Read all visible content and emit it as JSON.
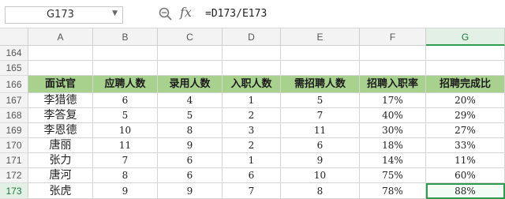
{
  "formula_bar": {
    "name_box": "G173",
    "formula": "=D173/E173"
  },
  "columns": [
    "A",
    "B",
    "C",
    "D",
    "E",
    "F",
    "G"
  ],
  "selected_column": "G",
  "rows": [
    {
      "num": "164",
      "cells": [
        "",
        "",
        "",
        "",
        "",
        "",
        ""
      ],
      "type": "blank"
    },
    {
      "num": "165",
      "cells": [
        "",
        "",
        "",
        "",
        "",
        "",
        ""
      ],
      "type": "blank"
    },
    {
      "num": "166",
      "cells": [
        "面试官",
        "应聘人数",
        "录用人数",
        "入职人数",
        "需招聘人数",
        "招聘入职率",
        "招聘完成比"
      ],
      "type": "header"
    },
    {
      "num": "167",
      "cells": [
        "李猎德",
        "6",
        "4",
        "1",
        "5",
        "17%",
        "20%"
      ],
      "type": "data"
    },
    {
      "num": "168",
      "cells": [
        "李答复",
        "5",
        "5",
        "2",
        "7",
        "40%",
        "29%"
      ],
      "type": "data"
    },
    {
      "num": "169",
      "cells": [
        "李恩德",
        "10",
        "8",
        "3",
        "11",
        "30%",
        "27%"
      ],
      "type": "data"
    },
    {
      "num": "170",
      "cells": [
        "唐丽",
        "11",
        "9",
        "2",
        "6",
        "18%",
        "33%"
      ],
      "type": "data"
    },
    {
      "num": "171",
      "cells": [
        "张力",
        "7",
        "6",
        "1",
        "9",
        "14%",
        "11%"
      ],
      "type": "data"
    },
    {
      "num": "172",
      "cells": [
        "唐河",
        "8",
        "6",
        "6",
        "10",
        "75%",
        "60%"
      ],
      "type": "data"
    },
    {
      "num": "173",
      "cells": [
        "张虎",
        "9",
        "9",
        "7",
        "8",
        "78%",
        "88%"
      ],
      "type": "data"
    }
  ],
  "active_row": "173"
}
